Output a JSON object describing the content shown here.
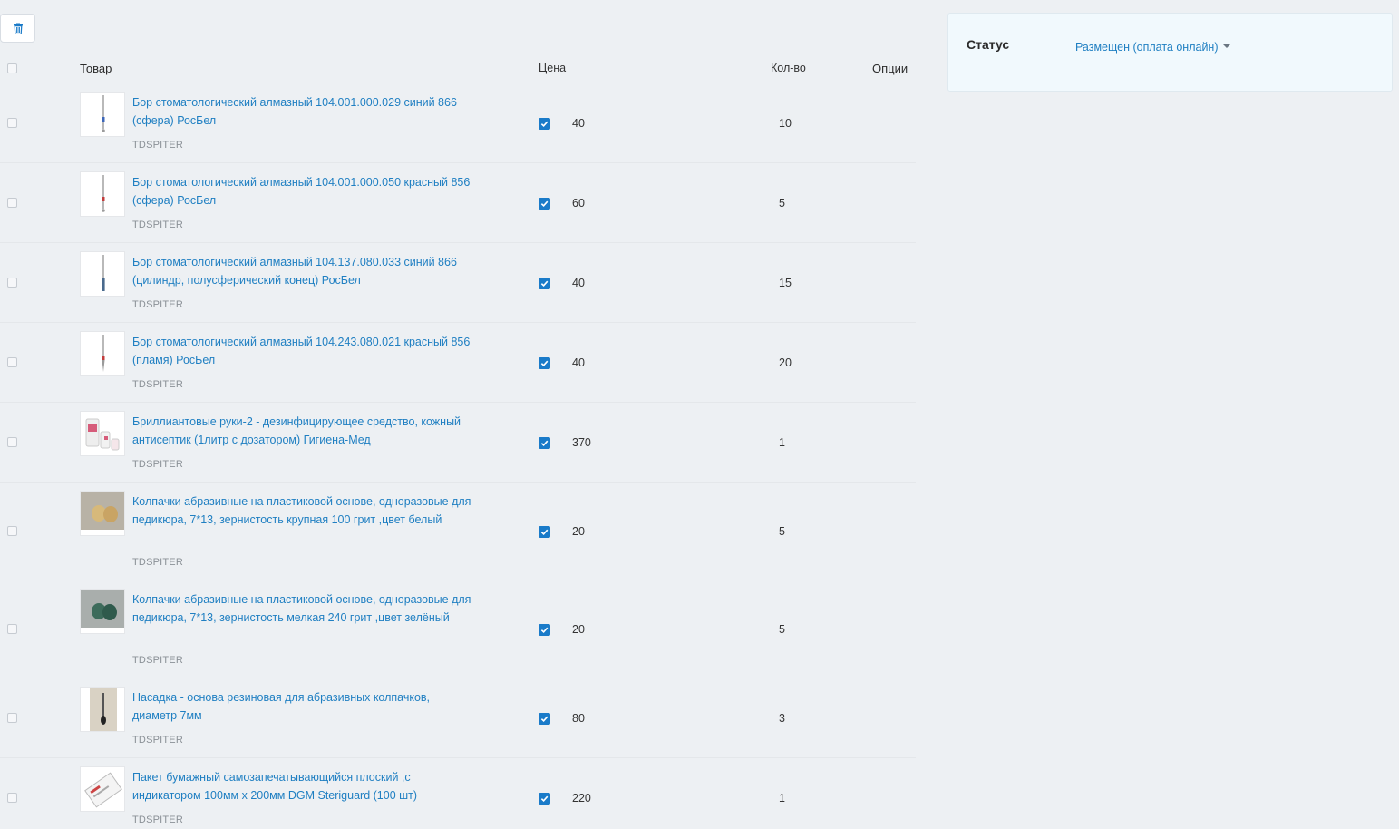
{
  "toolbar": {
    "delete_icon": "trash-icon"
  },
  "table": {
    "headers": {
      "product": "Товар",
      "price": "Цена",
      "qty": "Кол-во",
      "options": "Опции"
    },
    "rows": [
      {
        "title": "Бор стоматологический алмазный 104.001.000.029 синий 866 (сфера) РосБел",
        "vendor": "TDSPITER",
        "price": "40",
        "qty": "10",
        "checked": true
      },
      {
        "title": "Бор стоматологический алмазный 104.001.000.050 красный 856 (сфера) РосБел",
        "vendor": "TDSPITER",
        "price": "60",
        "qty": "5",
        "checked": true
      },
      {
        "title": "Бор стоматологический алмазный 104.137.080.033 синий 866 (цилиндр, полусферический конец) РосБел",
        "vendor": "TDSPITER",
        "price": "40",
        "qty": "15",
        "checked": true
      },
      {
        "title": "Бор стоматологический алмазный 104.243.080.021 красный 856 (пламя) РосБел",
        "vendor": "TDSPITER",
        "price": "40",
        "qty": "20",
        "checked": true
      },
      {
        "title": "Бриллиантовые руки-2 - дезинфицирующее средство, кожный антисептик (1литр с дозатором) Гигиена-Мед",
        "vendor": "TDSPITER",
        "price": "370",
        "qty": "1",
        "checked": true
      },
      {
        "title": "Колпачки абразивные на пластиковой основе, одноразовые для педикюра, 7*13, зернистость крупная 100 грит ,цвет белый",
        "vendor": "TDSPITER",
        "price": "20",
        "qty": "5",
        "checked": true
      },
      {
        "title": "Колпачки абразивные на пластиковой основе, одноразовые для педикюра, 7*13, зернистость мелкая 240 грит ,цвет зелёный",
        "vendor": "TDSPITER",
        "price": "20",
        "qty": "5",
        "checked": true
      },
      {
        "title": "Насадка - основа резиновая для абразивных колпачков, диаметр 7мм",
        "vendor": "TDSPITER",
        "price": "80",
        "qty": "3",
        "checked": true
      },
      {
        "title": "Пакет бумажный самозапечатывающийся плоский ,с индикатором 100мм х 200мм DGM Steriguard (100 шт)",
        "vendor": "TDSPITER",
        "price": "220",
        "qty": "1",
        "checked": true
      }
    ]
  },
  "status": {
    "label": "Статус",
    "value": "Размещен (оплата онлайн)"
  },
  "colors": {
    "link": "#1f7fc2",
    "checkbox_checked": "#1a7bc9",
    "panel_bg": "#f1f9fd"
  }
}
